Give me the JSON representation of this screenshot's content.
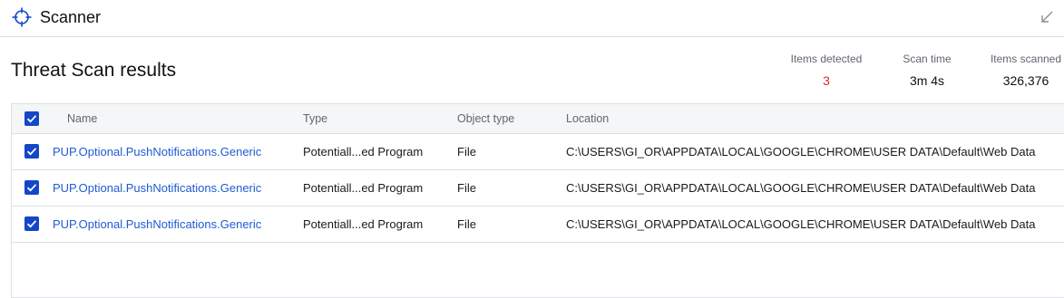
{
  "app": {
    "title": "Scanner"
  },
  "page": {
    "title": "Threat Scan results"
  },
  "stats": {
    "detected": {
      "label": "Items detected",
      "value": "3"
    },
    "scan_time": {
      "label": "Scan time",
      "value": "3m 4s"
    },
    "scanned": {
      "label": "Items scanned",
      "value": "326,376"
    }
  },
  "table": {
    "columns": {
      "name": "Name",
      "type": "Type",
      "object_type": "Object type",
      "location": "Location"
    },
    "rows": [
      {
        "name": "PUP.Optional.PushNotifications.Generic",
        "type": "Potentiall...ed Program",
        "object_type": "File",
        "location": "C:\\USERS\\GI_OR\\APPDATA\\LOCAL\\GOOGLE\\CHROME\\USER DATA\\Default\\Web Data",
        "checked": true
      },
      {
        "name": "PUP.Optional.PushNotifications.Generic",
        "type": "Potentiall...ed Program",
        "object_type": "File",
        "location": "C:\\USERS\\GI_OR\\APPDATA\\LOCAL\\GOOGLE\\CHROME\\USER DATA\\Default\\Web Data",
        "checked": true
      },
      {
        "name": "PUP.Optional.PushNotifications.Generic",
        "type": "Potentiall...ed Program",
        "object_type": "File",
        "location": "C:\\USERS\\GI_OR\\APPDATA\\LOCAL\\GOOGLE\\CHROME\\USER DATA\\Default\\Web Data",
        "checked": true
      }
    ]
  },
  "colors": {
    "accent": "#1447c8",
    "link": "#1f5bd2",
    "threat": "#d22f2f"
  },
  "icons": {
    "app": "crosshair-icon",
    "collapse": "collapse-arrow-icon",
    "check": "checkmark-icon"
  }
}
